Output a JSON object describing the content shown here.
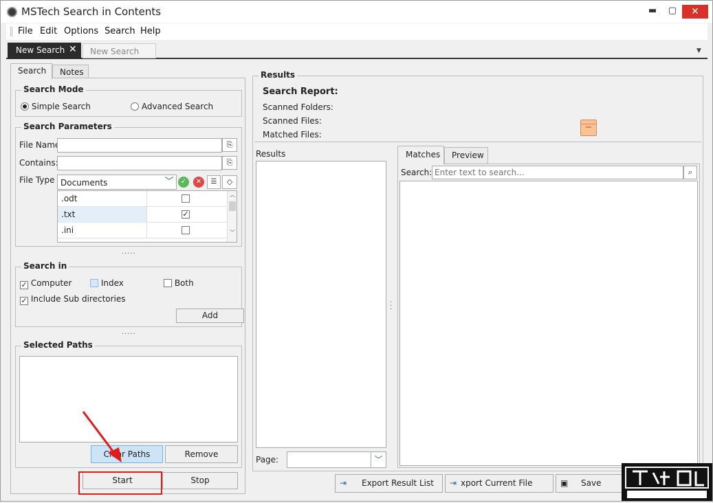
{
  "window": {
    "title": "MSTech Search in Contents",
    "minimize": "▬",
    "maximize": "▢",
    "close": "✕"
  },
  "menu": [
    "File",
    "Edit",
    "Options",
    "Search",
    "Help"
  ],
  "doc_tabs": {
    "active": "New Search",
    "inactive": "New Search",
    "close": "✕"
  },
  "left_tabs": [
    "Search",
    "Notes"
  ],
  "search_mode": {
    "title": "Search Mode",
    "simple": "Simple Search",
    "advanced": "Advanced Search",
    "selected": "simple"
  },
  "search_params": {
    "title": "Search Parameters",
    "file_name_label": "File Name",
    "contains_label": "Contains:",
    "file_type_label": "File Type",
    "file_type_value": "Documents",
    "rows": [
      {
        "ext": ".odt",
        "checked": false
      },
      {
        "ext": ".txt",
        "checked": true
      },
      {
        "ext": ".ini",
        "checked": false
      }
    ]
  },
  "search_in": {
    "title": "Search in",
    "computer": "Computer",
    "index": "Index",
    "both": "Both",
    "include_sub": "Include Sub directories",
    "computer_checked": true,
    "index_checked": false,
    "both_checked": false,
    "include_sub_checked": true,
    "add": "Add"
  },
  "selected_paths": {
    "title": "Selected Paths",
    "clear": "Clear Paths",
    "remove": "Remove"
  },
  "actions": {
    "start": "Start",
    "stop": "Stop"
  },
  "results": {
    "title": "Results",
    "report_title": "Search Report:",
    "scanned_folders": "Scanned Folders:",
    "scanned_files": "Scanned Files:",
    "matched_files": "Matched Files:",
    "list_label": "Results",
    "page_label": "Page:"
  },
  "right_tabs": [
    "Matches",
    "Preview"
  ],
  "search_box": {
    "label": "Search:",
    "placeholder": "Enter text to search..."
  },
  "bottom_buttons": [
    "Export Result List",
    "xport Current File Repor",
    "Save Searc"
  ],
  "dots": "....."
}
